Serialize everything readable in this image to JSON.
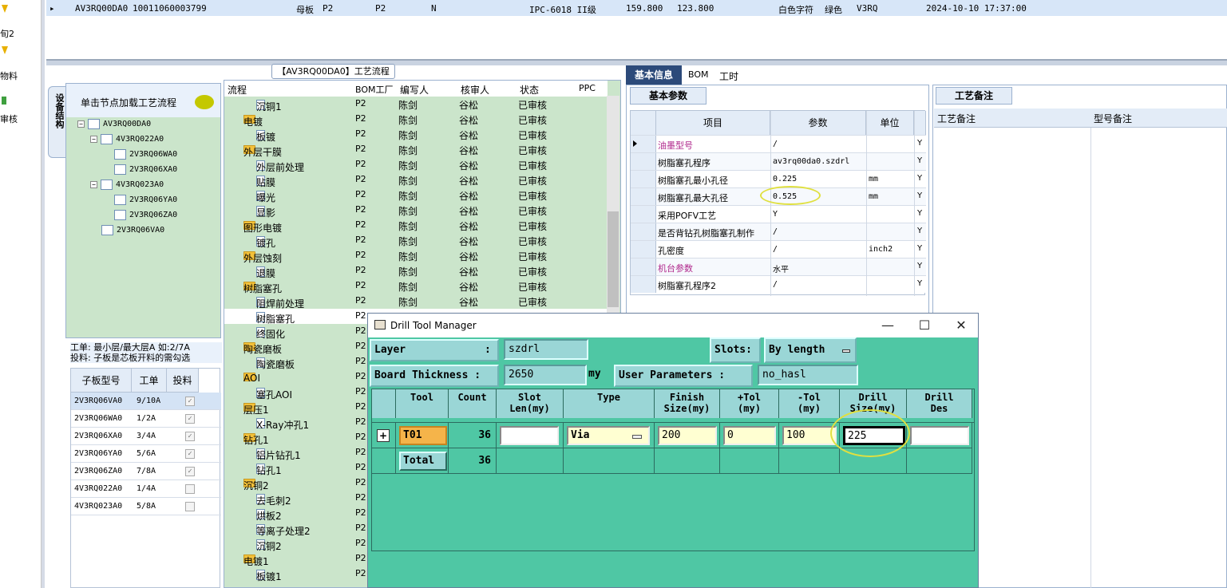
{
  "left_strip": {
    "items": [
      "旬2",
      "物料",
      "审核"
    ]
  },
  "top_row": {
    "marker": "▸",
    "cells": [
      "AV3RQ00DA0",
      "10011060003799",
      "母板",
      "P2",
      "P2",
      "N",
      "IPC-6018 II级",
      "159.800",
      "123.800",
      "白色字符",
      "绿色",
      "V3RQ",
      "2024-10-10 17:37:00"
    ]
  },
  "tree": {
    "vertical_tab": "设备结构",
    "header": "单击节点加载工艺流程",
    "nodes": [
      "AV3RQ00DA0",
      "4V3RQ022A0",
      "2V3RQ06WA0",
      "2V3RQ06XA0",
      "4V3RQ023A0",
      "2V3RQ06YA0",
      "2V3RQ06ZA0",
      "2V3RQ06VA0"
    ],
    "info_line1": "工单: 最小层/最大层A 如:2/7A",
    "info_line2": "投料: 子板是芯板开料的需勾选"
  },
  "sub_grid": {
    "headers": [
      "子板型号",
      "工单",
      "投料"
    ],
    "rows": [
      {
        "model": "2V3RQ06VA0",
        "order": "9/10A",
        "checked": true
      },
      {
        "model": "2V3RQ06WA0",
        "order": "1/2A",
        "checked": true
      },
      {
        "model": "2V3RQ06XA0",
        "order": "3/4A",
        "checked": true
      },
      {
        "model": "2V3RQ06YA0",
        "order": "5/6A",
        "checked": true
      },
      {
        "model": "2V3RQ06ZA0",
        "order": "7/8A",
        "checked": true
      },
      {
        "model": "4V3RQ022A0",
        "order": "1/4A",
        "checked": false
      },
      {
        "model": "4V3RQ023A0",
        "order": "5/8A",
        "checked": false
      }
    ],
    "check_mark": "✓"
  },
  "process": {
    "title": "【AV3RQ00DA0】工艺流程",
    "headers": [
      "流程",
      "BOM工厂",
      "编写人",
      "核审人",
      "状态",
      "PPC"
    ],
    "rows": [
      {
        "name": "沉铜1",
        "kind": "doc",
        "level": 2,
        "bom": "P2",
        "author": "陈剑",
        "reviewer": "谷松",
        "status": "已审核"
      },
      {
        "name": "电镀",
        "kind": "folder",
        "level": 1,
        "bom": "P2",
        "author": "陈剑",
        "reviewer": "谷松",
        "status": "已审核"
      },
      {
        "name": "板镀",
        "kind": "doc",
        "level": 2,
        "bom": "P2",
        "author": "陈剑",
        "reviewer": "谷松",
        "status": "已审核"
      },
      {
        "name": "外层干膜",
        "kind": "folder",
        "level": 1,
        "bom": "P2",
        "author": "陈剑",
        "reviewer": "谷松",
        "status": "已审核"
      },
      {
        "name": "外层前处理",
        "kind": "doc",
        "level": 2,
        "bom": "P2",
        "author": "陈剑",
        "reviewer": "谷松",
        "status": "已审核"
      },
      {
        "name": "贴膜",
        "kind": "doc",
        "level": 2,
        "bom": "P2",
        "author": "陈剑",
        "reviewer": "谷松",
        "status": "已审核"
      },
      {
        "name": "曝光",
        "kind": "doc",
        "level": 2,
        "bom": "P2",
        "author": "陈剑",
        "reviewer": "谷松",
        "status": "已审核"
      },
      {
        "name": "显影",
        "kind": "doc",
        "level": 2,
        "bom": "P2",
        "author": "陈剑",
        "reviewer": "谷松",
        "status": "已审核"
      },
      {
        "name": "图形电镀",
        "kind": "folder",
        "level": 1,
        "bom": "P2",
        "author": "陈剑",
        "reviewer": "谷松",
        "status": "已审核"
      },
      {
        "name": "镀孔",
        "kind": "doc",
        "level": 2,
        "bom": "P2",
        "author": "陈剑",
        "reviewer": "谷松",
        "status": "已审核"
      },
      {
        "name": "外层蚀刻",
        "kind": "folder",
        "level": 1,
        "bom": "P2",
        "author": "陈剑",
        "reviewer": "谷松",
        "status": "已审核"
      },
      {
        "name": "退膜",
        "kind": "doc",
        "level": 2,
        "bom": "P2",
        "author": "陈剑",
        "reviewer": "谷松",
        "status": "已审核"
      },
      {
        "name": "树脂塞孔",
        "kind": "folder",
        "level": 1,
        "bom": "P2",
        "author": "陈剑",
        "reviewer": "谷松",
        "status": "已审核"
      },
      {
        "name": "阻焊前处理",
        "kind": "doc",
        "level": 2,
        "bom": "P2",
        "author": "陈剑",
        "reviewer": "谷松",
        "status": "已审核"
      },
      {
        "name": "树脂塞孔",
        "kind": "doc",
        "level": 2,
        "bom": "P2",
        "author": "",
        "reviewer": "",
        "status": ""
      },
      {
        "name": "终固化",
        "kind": "doc",
        "level": 2,
        "bom": "P2",
        "author": "",
        "reviewer": "",
        "status": ""
      },
      {
        "name": "陶瓷磨板",
        "kind": "folder",
        "level": 1,
        "bom": "P2",
        "author": "",
        "reviewer": "",
        "status": ""
      },
      {
        "name": "陶瓷磨板",
        "kind": "doc",
        "level": 2,
        "bom": "P2",
        "author": "",
        "reviewer": "",
        "status": ""
      },
      {
        "name": "AOI",
        "kind": "folder",
        "level": 1,
        "bom": "P2",
        "author": "",
        "reviewer": "",
        "status": ""
      },
      {
        "name": "塞孔AOI",
        "kind": "doc",
        "level": 2,
        "bom": "P2",
        "author": "",
        "reviewer": "",
        "status": ""
      },
      {
        "name": "层压1",
        "kind": "folder",
        "level": 1,
        "bom": "P2",
        "author": "",
        "reviewer": "",
        "status": ""
      },
      {
        "name": "X-Ray冲孔1",
        "kind": "doc",
        "level": 2,
        "bom": "P2",
        "author": "",
        "reviewer": "",
        "status": ""
      },
      {
        "name": "钻孔1",
        "kind": "folder",
        "level": 1,
        "bom": "P2",
        "author": "",
        "reviewer": "",
        "status": ""
      },
      {
        "name": "铝片钻孔1",
        "kind": "doc",
        "level": 2,
        "bom": "P2",
        "author": "",
        "reviewer": "",
        "status": ""
      },
      {
        "name": "钻孔1",
        "kind": "doc",
        "level": 2,
        "bom": "P2",
        "author": "",
        "reviewer": "",
        "status": ""
      },
      {
        "name": "沉铜2",
        "kind": "folder",
        "level": 1,
        "bom": "P2",
        "author": "",
        "reviewer": "",
        "status": ""
      },
      {
        "name": "去毛刺2",
        "kind": "doc",
        "level": 2,
        "bom": "P2",
        "author": "",
        "reviewer": "",
        "status": ""
      },
      {
        "name": "烘板2",
        "kind": "doc",
        "level": 2,
        "bom": "P2",
        "author": "",
        "reviewer": "",
        "status": ""
      },
      {
        "name": "等离子处理2",
        "kind": "doc",
        "level": 2,
        "bom": "P2",
        "author": "",
        "reviewer": "",
        "status": ""
      },
      {
        "name": "沉铜2",
        "kind": "doc",
        "level": 2,
        "bom": "P2",
        "author": "",
        "reviewer": "",
        "status": ""
      },
      {
        "name": "电镀1",
        "kind": "folder",
        "level": 1,
        "bom": "P2",
        "author": "",
        "reviewer": "",
        "status": ""
      },
      {
        "name": "板镀1",
        "kind": "doc",
        "level": 2,
        "bom": "P2",
        "author": "",
        "reviewer": "",
        "status": ""
      }
    ]
  },
  "info_tabs": {
    "tabs": [
      "基本信息",
      "BOM",
      "工时"
    ],
    "active": "基本信息",
    "sub_tab": "基本参数"
  },
  "params": {
    "headers": [
      "项目",
      "参数",
      "单位"
    ],
    "rows": [
      {
        "item": "油墨型号",
        "value": "/",
        "unit": "",
        "flag": "Y",
        "pink": true,
        "current": true
      },
      {
        "item": "树脂塞孔程序",
        "value": "av3rq00da0.szdrl",
        "unit": "",
        "flag": "Y",
        "pink": false,
        "current": false
      },
      {
        "item": "树脂塞孔最小孔径",
        "value": "0.225",
        "unit": "mm",
        "flag": "Y",
        "pink": false,
        "current": false
      },
      {
        "item": "树脂塞孔最大孔径",
        "value": "0.525",
        "unit": "mm",
        "flag": "Y",
        "pink": false,
        "current": false
      },
      {
        "item": "采用POFV工艺",
        "value": "Y",
        "unit": "",
        "flag": "Y",
        "pink": false,
        "current": false
      },
      {
        "item": "是否背钻孔树脂塞孔制作",
        "value": "/",
        "unit": "",
        "flag": "Y",
        "pink": false,
        "current": false
      },
      {
        "item": "孔密度",
        "value": "/",
        "unit": "inch2",
        "flag": "Y",
        "pink": false,
        "current": false
      },
      {
        "item": "机台参数",
        "value": "水平",
        "unit": "",
        "flag": "Y",
        "pink": true,
        "current": false
      },
      {
        "item": "树脂塞孔程序2",
        "value": "/",
        "unit": "",
        "flag": "Y",
        "pink": false,
        "current": false
      }
    ]
  },
  "notes": {
    "tab": "工艺备注",
    "headers": [
      "工艺备注",
      "型号备注"
    ]
  },
  "dialog": {
    "title": "Drill Tool Manager",
    "controls": {
      "minimize": "—",
      "maximize": "☐",
      "close": "✕"
    },
    "layer_label": "Layer",
    "layer_colon": ":",
    "layer_value": "szdrl",
    "slots_label": "Slots:",
    "slots_value": "By length",
    "thickness_label": "Board Thickness :",
    "thickness_value": "2650",
    "thickness_unit": "my",
    "user_params_label": "User Parameters :",
    "user_params_value": "no_hasl",
    "table": {
      "headers": [
        {
          "l1": "Tool",
          "l2": ""
        },
        {
          "l1": "Count",
          "l2": ""
        },
        {
          "l1": "Slot",
          "l2": "Len(my)"
        },
        {
          "l1": "Type",
          "l2": ""
        },
        {
          "l1": "Finish",
          "l2": "Size(my)"
        },
        {
          "l1": "+Tol",
          "l2": "(my)"
        },
        {
          "l1": "-Tol",
          "l2": "(my)"
        },
        {
          "l1": "Drill",
          "l2": "Size(my)"
        },
        {
          "l1": "Drill",
          "l2": "Des"
        }
      ],
      "row": {
        "expand": "+",
        "tool": "T01",
        "count": "36",
        "slot_len": "",
        "type": "Via",
        "finish": "200",
        "ptol": "0",
        "mtol": "100",
        "drill_size": "225",
        "drill_des": ""
      },
      "total": {
        "label": "Total",
        "count": "36"
      }
    }
  },
  "colors": {
    "dialog_bg": "#4fc7a4",
    "tree_bg": "#cbe5cb",
    "header_bg": "#e3ecf7",
    "pink_text": "#b0288c",
    "active_tab": "#2c4a7a",
    "tool_highlight": "#f5b44a"
  }
}
